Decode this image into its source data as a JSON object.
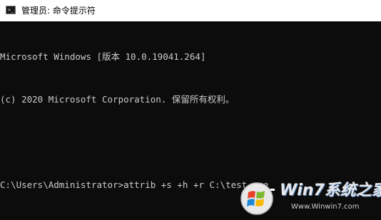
{
  "window": {
    "title": "管理员: 命令提示符",
    "icon": "cmd-icon"
  },
  "console": {
    "lines": [
      "Microsoft Windows [版本 10.0.19041.264]",
      "(c) 2020 Microsoft Corporation. 保留所有权利。",
      "",
      "C:\\Users\\Administrator>attrib +s +h +r C:\\test.exe"
    ]
  },
  "watermark": {
    "brand": "Win7系统之家",
    "url": "Www.Winwin7.com"
  },
  "colors": {
    "background": "#0c0c0c",
    "text": "#cccccc",
    "titlebar": "#ffffff"
  }
}
